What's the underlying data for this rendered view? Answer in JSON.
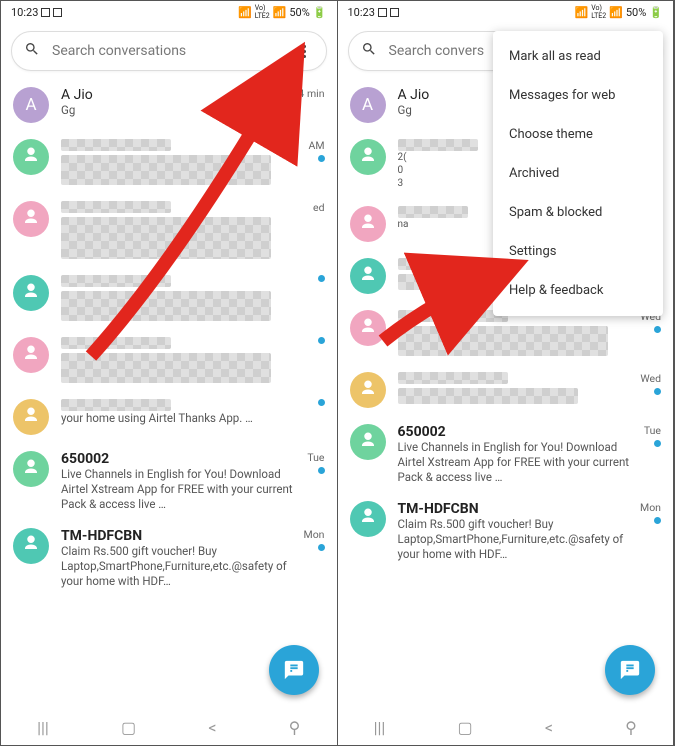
{
  "status": {
    "time": "10:23",
    "battery": "50%"
  },
  "search": {
    "placeholder": "Search conversations"
  },
  "conversations": {
    "ajio": {
      "name": "A Jio",
      "preview": "Gg",
      "time": "24 min"
    },
    "row1_time": "AM",
    "row2_time": "ed",
    "no650002": {
      "name": "650002",
      "preview": "Live Channels in English for You! Download Airtel Xstream App for FREE with your current Pack & access live …",
      "time": "Tue"
    },
    "tm": {
      "name": "TM-HDFCBN",
      "preview": "Claim Rs.500 gift voucher! Buy Laptop,SmartPhone,Furniture,etc.@safety of your home with HDF…",
      "time": "Mon"
    },
    "airtel_tail": "your home using Airtel Thanks App. …",
    "wed": "Wed",
    "tue": "Tue"
  },
  "right_preview_frag": {
    "l1": "2(",
    "l2": "0",
    "l3": "3"
  },
  "menu": {
    "mark": "Mark all as read",
    "web": "Messages for web",
    "theme": "Choose theme",
    "archived": "Archived",
    "spam": "Spam & blocked",
    "settings": "Settings",
    "help": "Help & feedback"
  },
  "nav_partial": "na",
  "trunc_search": "Search convers"
}
